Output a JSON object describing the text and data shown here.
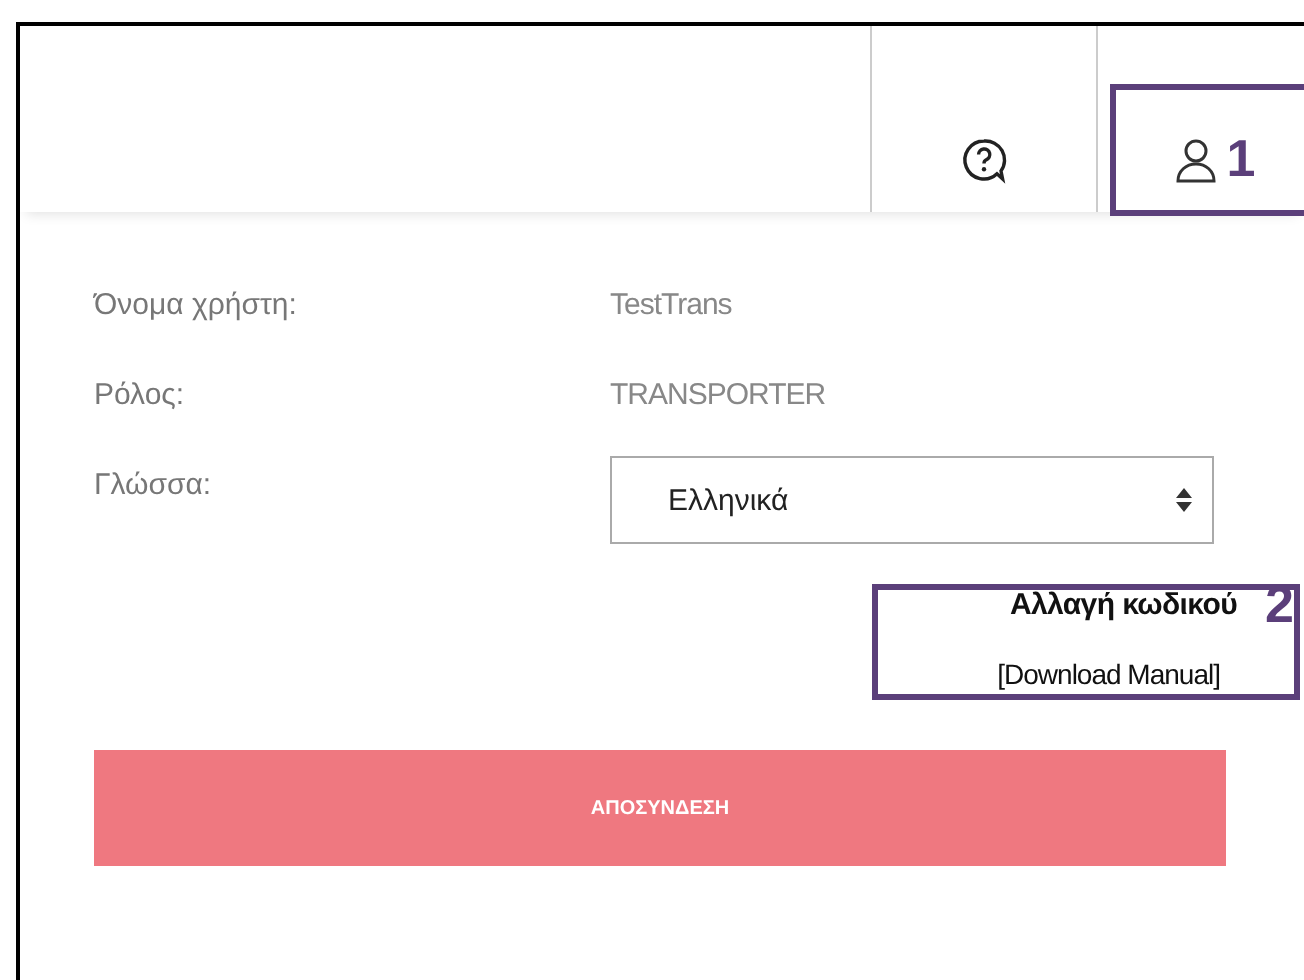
{
  "header": {
    "user_callout": "1"
  },
  "profile": {
    "fields": [
      {
        "label": "Όνομα χρήστη:",
        "value": "TestTrans"
      },
      {
        "label": "Ρόλος:",
        "value": "TRANSPORTER"
      }
    ],
    "language": {
      "label": "Γλώσσα:",
      "value": "Ελληνικά"
    },
    "change_password": {
      "text": "Αλλαγή κωδικού",
      "callout": "2"
    },
    "manual_link": "[Download Manual]",
    "logout_button": "ΑΠΟΣΥΝΔΕΣΗ"
  }
}
